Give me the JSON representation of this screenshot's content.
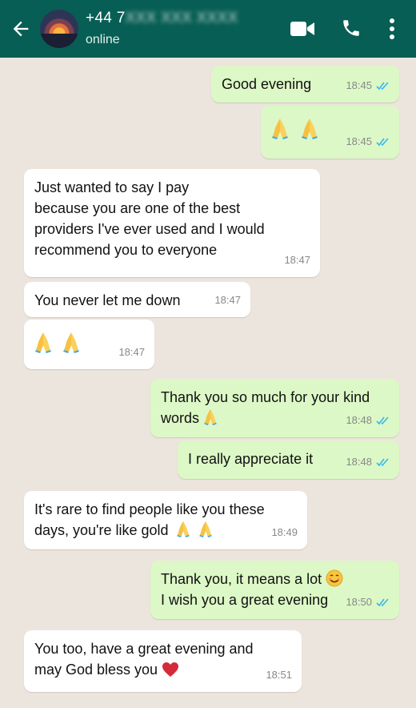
{
  "header": {
    "contact_prefix": "+44 7",
    "contact_blurred": "XXX XXX XXXX",
    "status": "online",
    "icons": [
      "back-arrow-icon",
      "video-call-icon",
      "phone-icon",
      "more-vert-icon"
    ],
    "colors": {
      "bar": "#075e54",
      "outgoing": "#dcf8c6",
      "incoming": "#ffffff",
      "background": "#ece5dd",
      "read_ticks": "#34b7f1"
    }
  },
  "messages": [
    {
      "dir": "out",
      "text": "Good evening",
      "time": "18:45",
      "status": "read"
    },
    {
      "dir": "out",
      "text": "🙏🙏",
      "time": "18:45",
      "status": "read"
    },
    {
      "dir": "in",
      "text": "Just wanted to say I pay because you are one of the best providers I've ever used and I would recommend you to everyone",
      "time": "18:47"
    },
    {
      "dir": "in",
      "text": "You never let me down",
      "time": "18:47"
    },
    {
      "dir": "in",
      "text": "🙏🙏",
      "time": "18:47"
    },
    {
      "dir": "out",
      "text": "Thank you so much for your kind words 🙏",
      "time": "18:48",
      "status": "read"
    },
    {
      "dir": "out",
      "text": "I really appreciate it",
      "time": "18:48",
      "status": "read"
    },
    {
      "dir": "in",
      "text": "It's rare to find people like you these days, you're like gold 🙏🙏",
      "time": "18:49"
    },
    {
      "dir": "out",
      "text": "Thank you, it means a lot 😊 I wish you a great evening",
      "time": "18:50",
      "status": "read"
    },
    {
      "dir": "in",
      "text": "You too, have a great evening and may God bless you ❤️",
      "time": "18:51"
    }
  ],
  "display": {
    "m0": "Good evening",
    "m2a": "Just wanted to say I pay",
    "m2b": "because you are one of the best",
    "m2c": "providers I've ever used and I would",
    "m2d": "recommend you to everyone",
    "m3": "You never let me down",
    "m5a": "Thank you so much for your kind",
    "m5b": "words",
    "m6": "I really appreciate it",
    "m7a": "It's rare to find people like you these",
    "m7b": "days, you're like gold",
    "m8a": "Thank you, it means a lot",
    "m8b": "I wish you a great evening",
    "m9a": "You too, have a great evening and",
    "m9b": "may God bless you"
  }
}
